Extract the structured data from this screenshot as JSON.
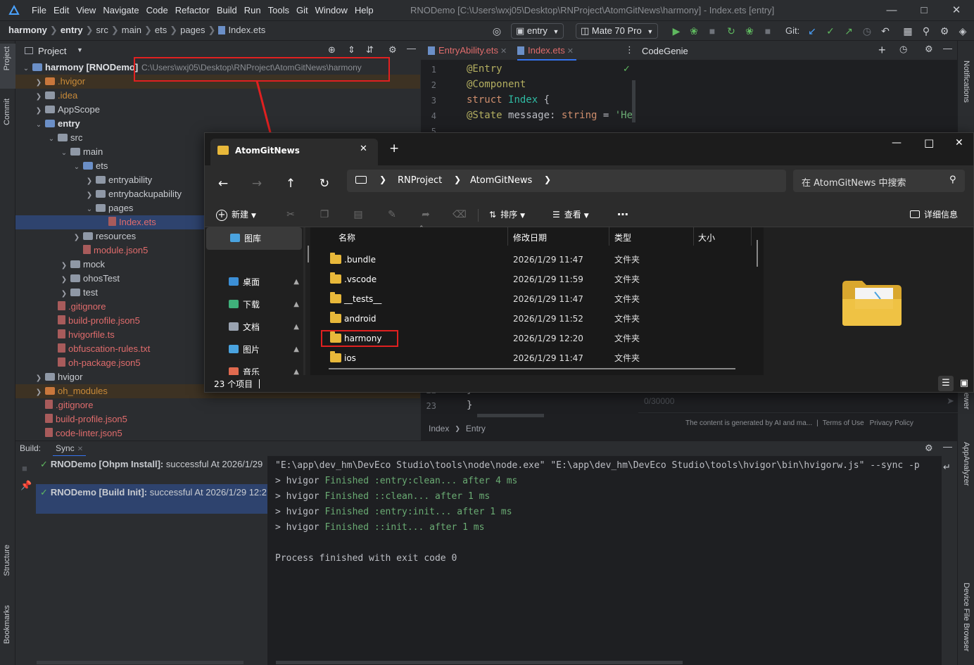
{
  "titlebar": {
    "menus": [
      "File",
      "Edit",
      "View",
      "Navigate",
      "Code",
      "Refactor",
      "Build",
      "Run",
      "Tools",
      "Git",
      "Window",
      "Help"
    ],
    "window_title": "RNODemo [C:\\Users\\wxj05\\Desktop\\RNProject\\AtomGitNews\\harmony] - Index.ets [entry]"
  },
  "breadcrumb": [
    "harmony",
    "entry",
    "src",
    "main",
    "ets",
    "pages",
    "Index.ets"
  ],
  "toolbar": {
    "module_select": "entry",
    "device_select": "Mate 70 Pro",
    "git_label": "Git:"
  },
  "left_stripe": {
    "project": "Project",
    "commit": "Commit",
    "structure": "Structure",
    "bookmarks": "Bookmarks"
  },
  "right_stripe": {
    "notifications": "Notifications",
    "viewer": "ewer",
    "appanalyzer": "AppAnalyzer",
    "device_file_browser": "Device File Browser"
  },
  "project_panel": {
    "title": "Project",
    "root_path": "C:\\Users\\wxj05\\Desktop\\RNProject\\AtomGitNews\\harmony",
    "tree": [
      {
        "label": "harmony [RNODemo]",
        "icon": "module-folder",
        "style": "bold",
        "indent": 0,
        "chev": "down"
      },
      {
        "label": ".hvigor",
        "icon": "orange-folder",
        "style": "orange",
        "indent": 1,
        "chev": "right",
        "highlight": true
      },
      {
        "label": ".idea",
        "icon": "folder",
        "style": "orange",
        "indent": 1,
        "chev": "right"
      },
      {
        "label": "AppScope",
        "icon": "folder",
        "style": "normal",
        "indent": 1,
        "chev": "right"
      },
      {
        "label": "entry",
        "icon": "module-folder",
        "style": "bold",
        "indent": 1,
        "chev": "down"
      },
      {
        "label": "src",
        "icon": "folder",
        "style": "normal",
        "indent": 2,
        "chev": "down"
      },
      {
        "label": "main",
        "icon": "folder",
        "style": "normal",
        "indent": 3,
        "chev": "down"
      },
      {
        "label": "ets",
        "icon": "module-folder",
        "style": "normal",
        "indent": 4,
        "chev": "down"
      },
      {
        "label": "entryability",
        "icon": "folder",
        "style": "normal",
        "indent": 5,
        "chev": "right"
      },
      {
        "label": "entrybackupability",
        "icon": "folder",
        "style": "normal",
        "indent": 5,
        "chev": "right"
      },
      {
        "label": "pages",
        "icon": "folder",
        "style": "normal",
        "indent": 5,
        "chev": "down"
      },
      {
        "label": "Index.ets",
        "icon": "file",
        "style": "red",
        "indent": 6,
        "chev": "",
        "selected": true
      },
      {
        "label": "resources",
        "icon": "folder",
        "style": "normal",
        "indent": 4,
        "chev": "right"
      },
      {
        "label": "module.json5",
        "icon": "file",
        "style": "red",
        "indent": 4,
        "chev": ""
      },
      {
        "label": "mock",
        "icon": "folder",
        "style": "normal",
        "indent": 3,
        "chev": "right"
      },
      {
        "label": "ohosTest",
        "icon": "folder",
        "style": "normal",
        "indent": 3,
        "chev": "right"
      },
      {
        "label": "test",
        "icon": "folder",
        "style": "normal",
        "indent": 3,
        "chev": "right"
      },
      {
        "label": ".gitignore",
        "icon": "file",
        "style": "red",
        "indent": 2,
        "chev": ""
      },
      {
        "label": "build-profile.json5",
        "icon": "file",
        "style": "red",
        "indent": 2,
        "chev": ""
      },
      {
        "label": "hvigorfile.ts",
        "icon": "file",
        "style": "red",
        "indent": 2,
        "chev": ""
      },
      {
        "label": "obfuscation-rules.txt",
        "icon": "file",
        "style": "red",
        "indent": 2,
        "chev": ""
      },
      {
        "label": "oh-package.json5",
        "icon": "file",
        "style": "red",
        "indent": 2,
        "chev": ""
      },
      {
        "label": "hvigor",
        "icon": "folder",
        "style": "normal",
        "indent": 1,
        "chev": "right"
      },
      {
        "label": "oh_modules",
        "icon": "orange-folder",
        "style": "orange",
        "indent": 1,
        "chev": "right",
        "highlight": true
      },
      {
        "label": ".gitignore",
        "icon": "file",
        "style": "red",
        "indent": 1,
        "chev": ""
      },
      {
        "label": "build-profile.json5",
        "icon": "file",
        "style": "red",
        "indent": 1,
        "chev": ""
      },
      {
        "label": "code-linter.json5",
        "icon": "file",
        "style": "red",
        "indent": 1,
        "chev": ""
      }
    ]
  },
  "editor": {
    "tabs": [
      {
        "label": "EntryAbility.ets",
        "active": false
      },
      {
        "label": "Index.ets",
        "active": true
      }
    ],
    "lines": [
      {
        "n": "1",
        "tokens": [
          [
            "ann",
            "@Entry"
          ]
        ]
      },
      {
        "n": "2",
        "tokens": [
          [
            "ann",
            "@Component"
          ]
        ]
      },
      {
        "n": "3",
        "tokens": [
          [
            "kw",
            "struct "
          ],
          [
            "cls",
            "Index "
          ],
          [
            "id",
            "{"
          ]
        ]
      },
      {
        "n": "4",
        "tokens": [
          [
            "ann",
            "  @State "
          ],
          [
            "id",
            "message: "
          ],
          [
            "kw",
            "string "
          ],
          [
            "id",
            "= "
          ],
          [
            "str",
            "'He"
          ]
        ]
      },
      {
        "n": "5",
        "tokens": []
      }
    ],
    "bottom_lines": [
      {
        "n": "22",
        "text": "  }"
      },
      {
        "n": "23",
        "text": "}"
      }
    ],
    "breadcrumb": [
      "Index",
      "Entry"
    ]
  },
  "codegenie": {
    "title": "CodeGenie",
    "counter": "0/30000",
    "footer": "The content is generated by AI and ma...",
    "terms": "Terms of Use",
    "privacy": "Privacy Policy"
  },
  "build_panel": {
    "label": "Build:",
    "tab": "Sync",
    "items": [
      {
        "title": "RNODemo [Ohpm Install]:",
        "status": "successful",
        "time": "At 2026/1/29"
      },
      {
        "title": "RNODemo [Build Init]:",
        "status": "successful",
        "time": "At 2026/1/29 12:2"
      }
    ],
    "console": [
      {
        "prefix": "\"E:\\app\\dev_hm\\DevEco Studio\\tools\\node\\node.exe\" \"E:\\app\\dev_hm\\DevEco Studio\\tools\\hvigor\\bin\\hvigorw.js\" --sync -p",
        "green": "",
        "suffix": ""
      },
      {
        "prefix": "> hvigor ",
        "green": "Finished :entry:clean... after 4 ms",
        "suffix": ""
      },
      {
        "prefix": "> hvigor ",
        "green": "Finished ::clean... after 1 ms",
        "suffix": ""
      },
      {
        "prefix": "> hvigor ",
        "green": "Finished :entry:init... after 1 ms",
        "suffix": ""
      },
      {
        "prefix": "> hvigor ",
        "green": "Finished ::init... after 1 ms",
        "suffix": ""
      },
      {
        "prefix": "",
        "green": "",
        "suffix": ""
      },
      {
        "prefix": "Process finished with exit code 0",
        "green": "",
        "suffix": ""
      }
    ]
  },
  "explorer": {
    "tab_title": "AtomGitNews",
    "address": [
      "RNProject",
      "AtomGitNews"
    ],
    "search_placeholder": "在 AtomGitNews 中搜索",
    "commands": {
      "new": "新建",
      "sort": "排序",
      "view": "查看",
      "details": "详细信息"
    },
    "sidebar": [
      {
        "label": "图库",
        "pinned": false,
        "selected": true,
        "color": "#4aa3df"
      },
      {
        "label": "桌面",
        "pinned": true,
        "color": "#3c8fd6"
      },
      {
        "label": "下载",
        "pinned": true,
        "color": "#3fb07a"
      },
      {
        "label": "文档",
        "pinned": true,
        "color": "#9aa3b1"
      },
      {
        "label": "图片",
        "pinned": true,
        "color": "#4aa3df"
      },
      {
        "label": "音乐",
        "pinned": true,
        "color": "#e06a4f"
      }
    ],
    "columns": [
      "名称",
      "修改日期",
      "类型",
      "大小"
    ],
    "files": [
      {
        "name": ".bundle",
        "date": "2026/1/29 11:47",
        "type": "文件夹"
      },
      {
        "name": ".vscode",
        "date": "2026/1/29 11:59",
        "type": "文件夹"
      },
      {
        "name": "__tests__",
        "date": "2026/1/29 11:47",
        "type": "文件夹"
      },
      {
        "name": "android",
        "date": "2026/1/29 11:52",
        "type": "文件夹"
      },
      {
        "name": "harmony",
        "date": "2026/1/29 12:20",
        "type": "文件夹"
      },
      {
        "name": "ios",
        "date": "2026/1/29 11:47",
        "type": "文件夹"
      }
    ],
    "status": "23 个项目"
  }
}
